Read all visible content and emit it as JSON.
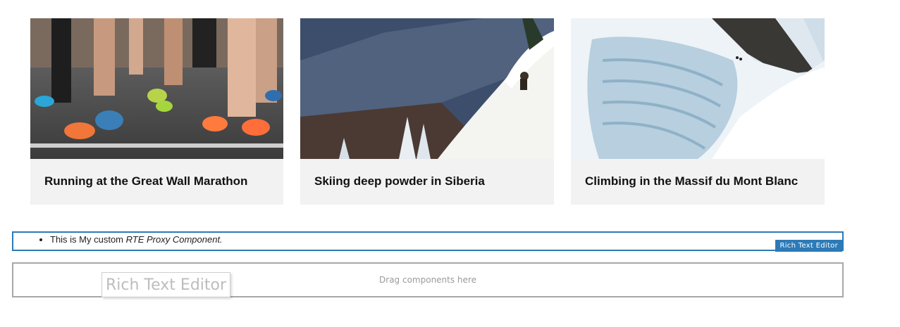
{
  "cards": [
    {
      "title": "Running at the Great Wall Marathon",
      "image_alt": "runners-legs-photo"
    },
    {
      "title": "Skiing deep powder in Siberia",
      "image_alt": "skier-powder-photo"
    },
    {
      "title": "Climbing in the Massif du Mont Blanc",
      "image_alt": "glacier-climbers-photo"
    }
  ],
  "rte": {
    "text_plain": "This is My custom ",
    "text_italic": "RTE Proxy Component.",
    "badge": "Rich Text Editor"
  },
  "dropzone": {
    "placeholder": "Drag components here",
    "drag_ghost": "Rich Text Editor"
  }
}
